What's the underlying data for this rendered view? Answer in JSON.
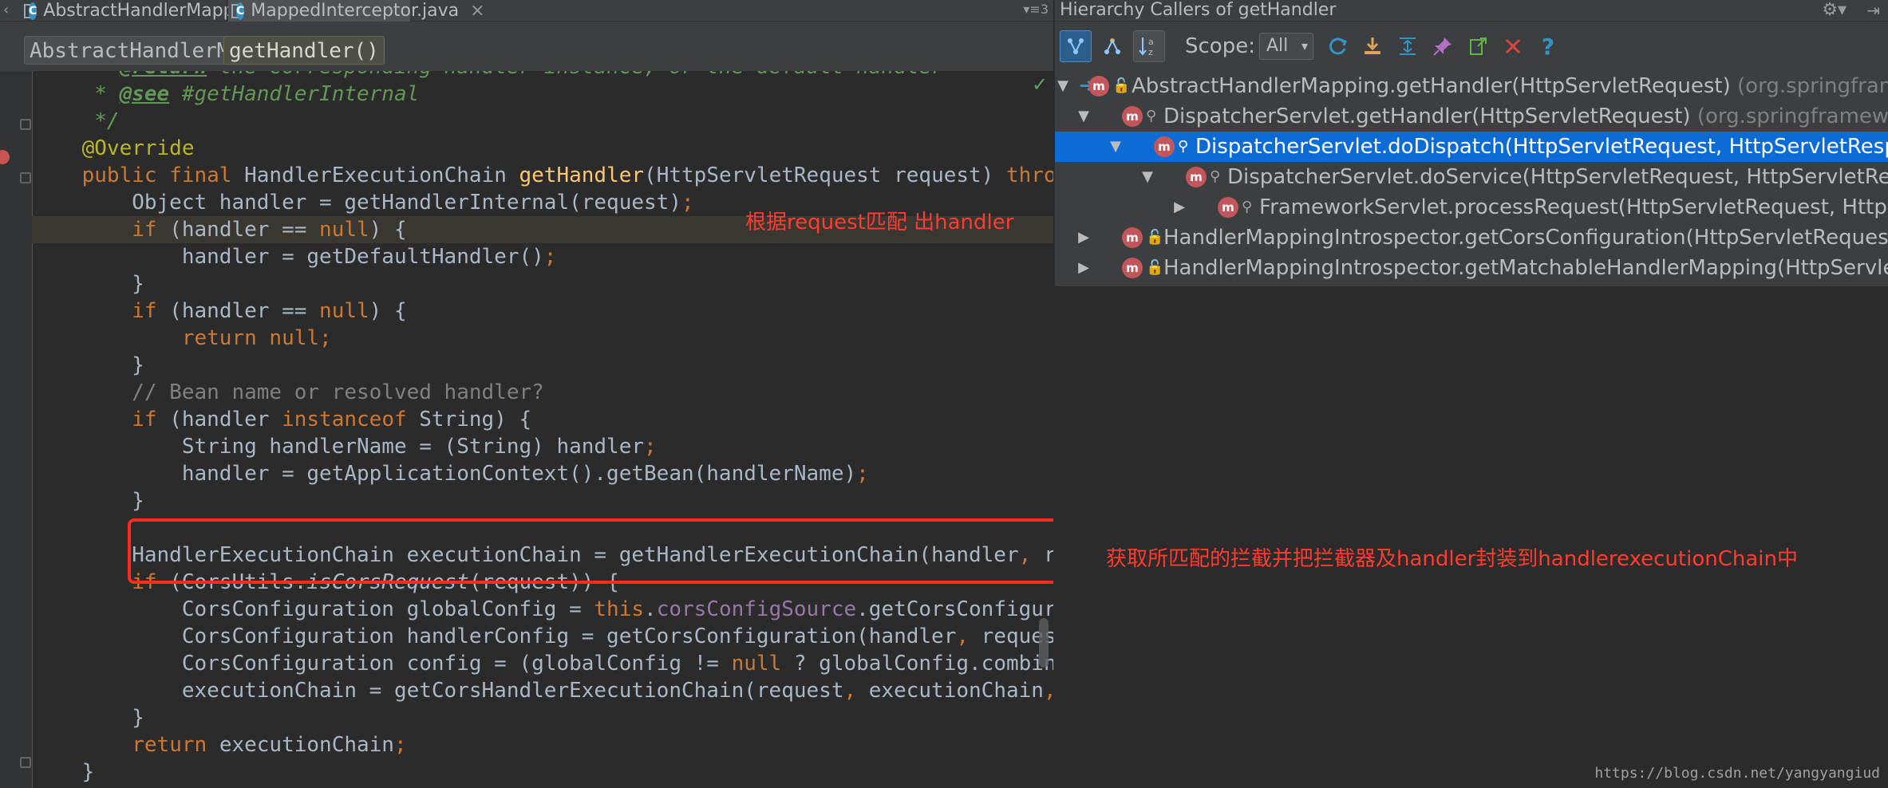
{
  "editor": {
    "tabs": [
      {
        "label": "AbstractHandlerMapping.java",
        "close": "×"
      },
      {
        "label": "MappedInterceptor.java",
        "close": "×"
      }
    ],
    "tab_overflow": "▾≡3",
    "tab_left_arrow": "‹",
    "breadcrumbs": [
      "AbstractHandlerMapping",
      "getHandler()"
    ],
    "code_lines": [
      "     * @return the corresponding handler instance, or the default handler",
      "     * @see #getHandlerInternal",
      "     */",
      "    @Override",
      "    public final HandlerExecutionChain getHandler(HttpServletRequest request) throws Exception {",
      "        Object handler = getHandlerInternal(request);",
      "        if (handler == null) {",
      "            handler = getDefaultHandler();",
      "        }",
      "        if (handler == null) {",
      "            return null;",
      "        }",
      "        // Bean name or resolved handler?",
      "        if (handler instanceof String) {",
      "            String handlerName = (String) handler;",
      "            handler = getApplicationContext().getBean(handlerName);",
      "        }",
      "",
      "        HandlerExecutionChain executionChain = getHandlerExecutionChain(handler, request);",
      "        if (CorsUtils.isCorsRequest(request)) {",
      "            CorsConfiguration globalConfig = this.corsConfigSource.getCorsConfiguration(request);",
      "            CorsConfiguration handlerConfig = getCorsConfiguration(handler, request);",
      "            CorsConfiguration config = (globalConfig != null ? globalConfig.combine(handlerConfig) : handlerConfig);",
      "            executionChain = getCorsHandlerExecutionChain(request, executionChain, config);",
      "        }",
      "        return executionChain;",
      "    }"
    ],
    "annotations": {
      "note_handler": "根据request匹配 出handler",
      "note_chain": "获取所匹配的拦截并把拦截器及handler封装到handlerexecutionChain中"
    }
  },
  "hierarchy": {
    "title": "Hierarchy Callers of getHandler",
    "gear": "⚙▾",
    "hide": "⇥",
    "scope_label": "Scope:",
    "scope_value": "All",
    "rows": [
      {
        "method": "AbstractHandlerMapping.getHandler(HttpServletRequest)",
        "pkg": "(org.springframework.web.servlet.handler)",
        "expanded": true,
        "selected": false
      },
      {
        "method": "DispatcherServlet.getHandler(HttpServletRequest)",
        "pkg": "(org.springframework.web.servlet)",
        "expanded": true,
        "selected": false
      },
      {
        "method": "DispatcherServlet.doDispatch(HttpServletRequest, HttpServletResponse)",
        "pkg": "",
        "expanded": true,
        "selected": true
      },
      {
        "method": "DispatcherServlet.doService(HttpServletRequest, HttpServletResponse)",
        "pkg": "",
        "expanded": true,
        "selected": false
      },
      {
        "method": "FrameworkServlet.processRequest(HttpServletRequest, HttpServletResponse)",
        "pkg": "",
        "expanded": false,
        "selected": false
      },
      {
        "method": "HandlerMappingIntrospector.getCorsConfiguration(HttpServletRequest)",
        "pkg": "",
        "expanded": false,
        "selected": false
      },
      {
        "method": "HandlerMappingIntrospector.getMatchableHandlerMapping(HttpServletRequest)",
        "pkg": "",
        "expanded": false,
        "selected": false
      }
    ]
  },
  "watermark": "https://blog.csdn.net/yangyangiud"
}
